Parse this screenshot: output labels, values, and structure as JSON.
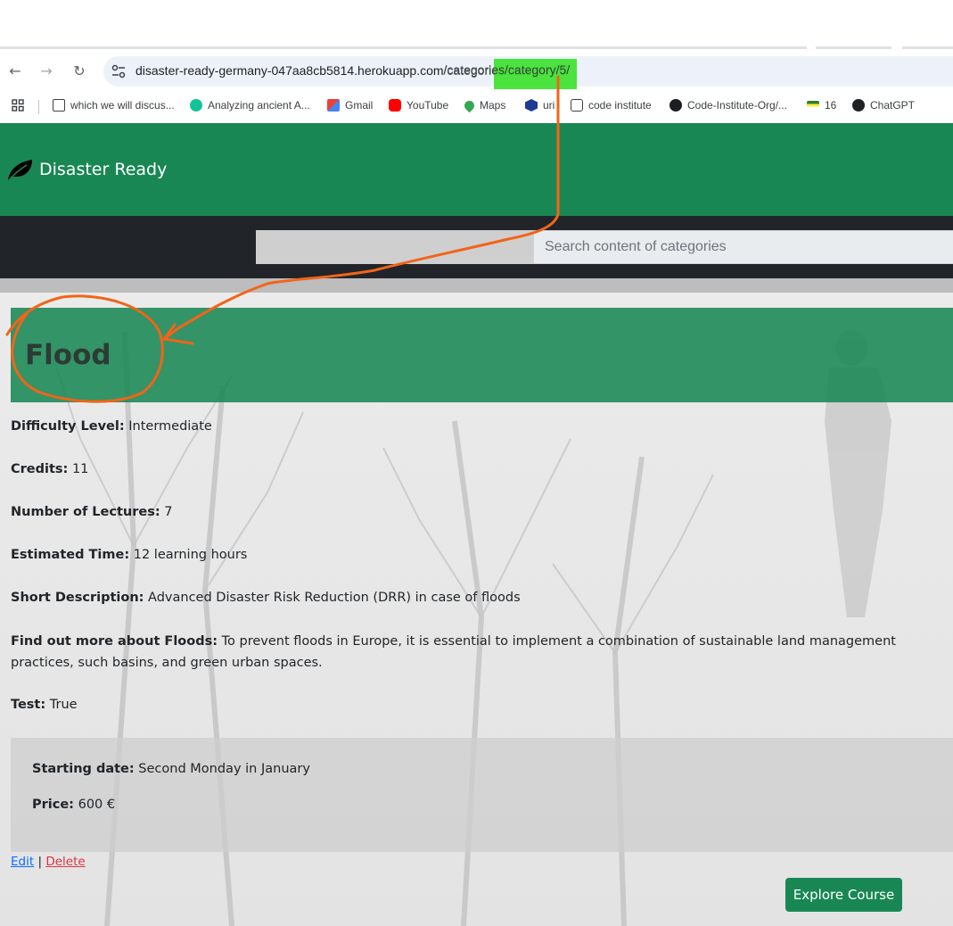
{
  "browser": {
    "url_host": "disaster-ready-germany-047aa8cb5814.herokuapp.com",
    "url_path": "/categories/category/5/",
    "highlight_color": "#2ee01c",
    "bookmarks": [
      {
        "label": "which we will discus...",
        "icon": "doc-icon",
        "color": "#3c4043"
      },
      {
        "label": "Analyzing ancient A...",
        "icon": "grammarly-icon",
        "color": "#15c39a"
      },
      {
        "label": "Gmail",
        "icon": "gmail-icon",
        "color": "#ea4335"
      },
      {
        "label": "YouTube",
        "icon": "youtube-icon",
        "color": "#ff0000"
      },
      {
        "label": "Maps",
        "icon": "maps-icon",
        "color": "#34a853"
      },
      {
        "label": "uri",
        "icon": "uri-icon",
        "color": "#1f3a93"
      },
      {
        "label": "code institute",
        "icon": "ci-icon",
        "color": "#3c4043"
      },
      {
        "label": "Code-Institute-Org/...",
        "icon": "github-icon",
        "color": "#000000"
      },
      {
        "label": "16",
        "icon": "flag-icon",
        "color": "#2e7d32"
      },
      {
        "label": "ChatGPT",
        "icon": "chatgpt-icon",
        "color": "#000000"
      }
    ]
  },
  "site": {
    "brand": "Disaster Ready",
    "brand_color": "#198754",
    "search_placeholder": "Search content of categories"
  },
  "category": {
    "title": "Flood",
    "fields": [
      {
        "label": "Difficulty Level:",
        "value": " Intermediate"
      },
      {
        "label": "Credits:",
        "value": " 11"
      },
      {
        "label": "Number of Lectures:",
        "value": " 7"
      },
      {
        "label": "Estimated Time:",
        "value": " 12 learning hours"
      },
      {
        "label": "Short Description:",
        "value": " Advanced Disaster Risk Reduction (DRR) in case of floods"
      },
      {
        "label": "Find out more about Floods:",
        "value": " To prevent floods in Europe, it is essential to implement a combination of sustainable land management practices, such basins, and green urban spaces."
      },
      {
        "label": "Test:",
        "value": " True"
      }
    ],
    "starting_date_label": "Starting date:",
    "starting_date_value": " Second Monday in January",
    "price_label": "Price:",
    "price_value": " 600  €",
    "edit_label": "Edit",
    "separator": "|",
    "delete_label": "Delete",
    "explore_label": "Explore Course"
  },
  "annotation_color": "#f26419"
}
